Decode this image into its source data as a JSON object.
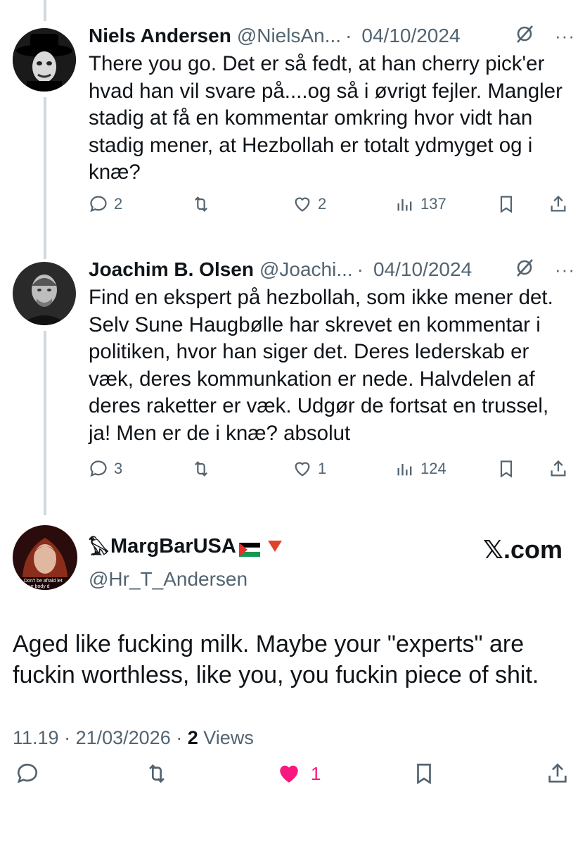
{
  "tweets": [
    {
      "name": "Niels Andersen",
      "handle": "@NielsAn...",
      "date": "04/10/2024",
      "text": "There you go. Det er så fedt, at han cherry pick'er hvad han vil svare på....og så i øvrigt fejler. Mangler stadig at få en kommentar omkring hvor vidt han stadig mener, at Hezbollah er totalt ydmyget og i knæ?",
      "replies": "2",
      "retweets": "",
      "likes": "2",
      "views": "137"
    },
    {
      "name": "Joachim B. Olsen",
      "handle": "@Joachi...",
      "date": "04/10/2024",
      "text": "Find en ekspert på hezbollah, som ikke mener det. Selv Sune Haugbølle har skrevet en kommentar i politiken, hvor han siger det. Deres lederskab er væk, deres kommunkation er nede. Halvdelen af deres raketter er væk. Udgør de fortsat en trussel, ja! Men er de i knæ? absolut",
      "replies": "3",
      "retweets": "",
      "likes": "1",
      "views": "124"
    }
  ],
  "main": {
    "name": "MargBarUSA",
    "name_prefix_emoji": "𓅃",
    "flag_emoji": "🇵🇸",
    "triangle_emoji": "🔻",
    "handle": "@Hr_T_Andersen",
    "watermark": "𝕏.com",
    "text": "Aged like fucking milk. Maybe your \"experts\" are fuckin worthless, like you, you fuckin piece of shit.",
    "time": "11.19",
    "date": "21/03/2026",
    "views_count": "2",
    "views_label": "Views",
    "likes": "1",
    "avatar_caption": "Don't be afraid let your body d"
  },
  "colors": {
    "text": "#0f1419",
    "muted": "#536471",
    "like_active": "#f91880",
    "thread_line": "#cfd9de"
  },
  "icons": [
    "reply-icon",
    "retweet-icon",
    "like-icon",
    "views-icon",
    "bookmark-icon",
    "share-icon",
    "grok-icon",
    "more-icon"
  ]
}
